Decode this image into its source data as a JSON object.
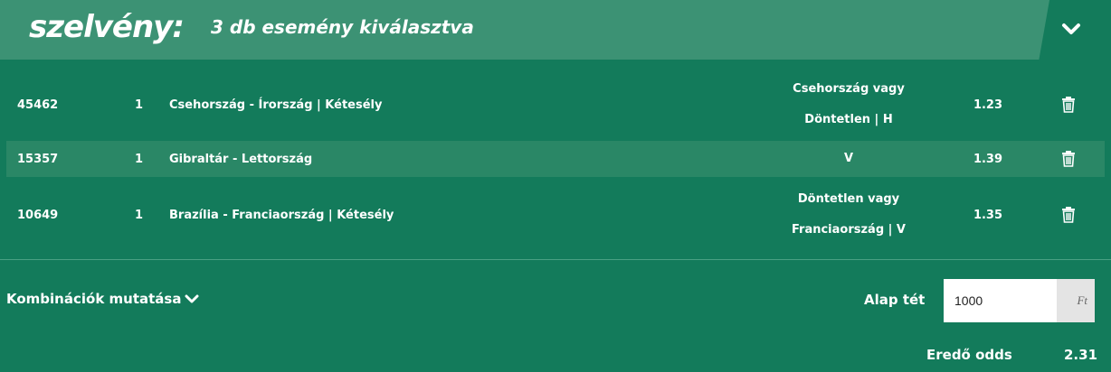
{
  "header": {
    "brand": "szelvény:",
    "subtitle": "3 db esemény kiválasztva",
    "toggle_icon": "chevron-down-icon"
  },
  "rows": [
    {
      "id": "45462",
      "multiplier": "1",
      "match": "Csehország - Írország | Kétesély",
      "tip_line1": "Csehország vagy",
      "tip_line2": "Döntetlen | H",
      "odds": "1.23",
      "delete_icon": "trash-icon"
    },
    {
      "id": "15357",
      "multiplier": "1",
      "match": "Gibraltár - Lettország",
      "tip_line1": "V",
      "tip_line2": "",
      "odds": "1.39",
      "delete_icon": "trash-icon"
    },
    {
      "id": "10649",
      "multiplier": "1",
      "match": "Brazília - Franciaország | Kétesély",
      "tip_line1": "Döntetlen vagy",
      "tip_line2": "Franciaország | V",
      "odds": "1.35",
      "delete_icon": "trash-icon"
    }
  ],
  "footer": {
    "combinations_label": "Kombinációk mutatása",
    "stake_label": "Alap tét",
    "stake_value": "1000",
    "stake_unit": "Ft",
    "total_odds_label": "Eredő odds",
    "total_odds_value": "2.31"
  },
  "colors": {
    "background": "#137b5b",
    "header_band": "#3c9274",
    "alt_row": "#2a8766"
  }
}
